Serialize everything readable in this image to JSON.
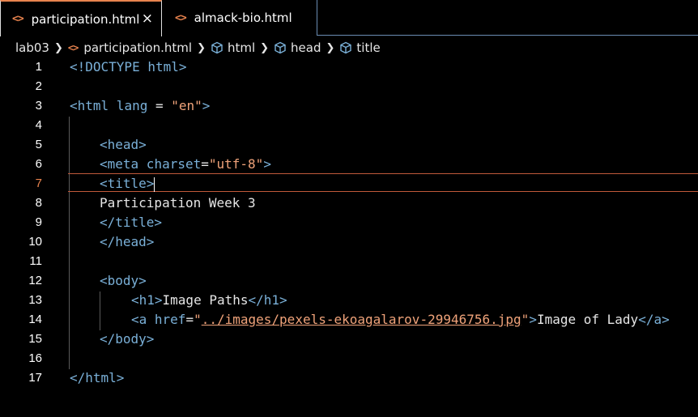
{
  "tabs": [
    {
      "icon": "<>",
      "label": "participation.html",
      "close": "×"
    },
    {
      "icon": "<>",
      "label": "almack-bio.html"
    }
  ],
  "breadcrumb": {
    "folder": "lab03",
    "file_icon": "<>",
    "file": "participation.html",
    "items": [
      "html",
      "head",
      "title"
    ]
  },
  "editor": {
    "active_line": 7,
    "line_numbers": [
      "1",
      "2",
      "3",
      "4",
      "5",
      "6",
      "7",
      "8",
      "9",
      "10",
      "11",
      "12",
      "13",
      "14",
      "15",
      "16",
      "17"
    ],
    "tokens": {
      "l1_a": "<!DOCTYPE",
      "l1_b": " html",
      "l1_c": ">",
      "l3_a": "<html",
      "l3_b": " lang",
      "l3_c": " = ",
      "l3_d": "\"en\"",
      "l3_e": ">",
      "l5": "<head>",
      "l6_a": "<meta",
      "l6_b": " charset",
      "l6_c": "=",
      "l6_d": "\"utf-8\"",
      "l6_e": ">",
      "l7": "<title>",
      "l8": "Participation Week 3",
      "l9": "</title>",
      "l10": "</head>",
      "l12": "<body>",
      "l13_a": "<h1>",
      "l13_b": "Image Paths",
      "l13_c": "</h1>",
      "l14_a": "<a",
      "l14_b": " href",
      "l14_c": "=",
      "l14_d": "\"",
      "l14_e": "../images/pexels-ekoagalarov-29946756.jpg",
      "l14_f": "\"",
      "l14_g": ">",
      "l14_h": "Image of Lady",
      "l14_i": "</a>",
      "l15": "</body>",
      "l17": "</html>"
    }
  },
  "colors": {
    "accent": "#e8834e",
    "tag": "#7ab0d8",
    "string": "#f0a37a",
    "background": "#000000"
  }
}
